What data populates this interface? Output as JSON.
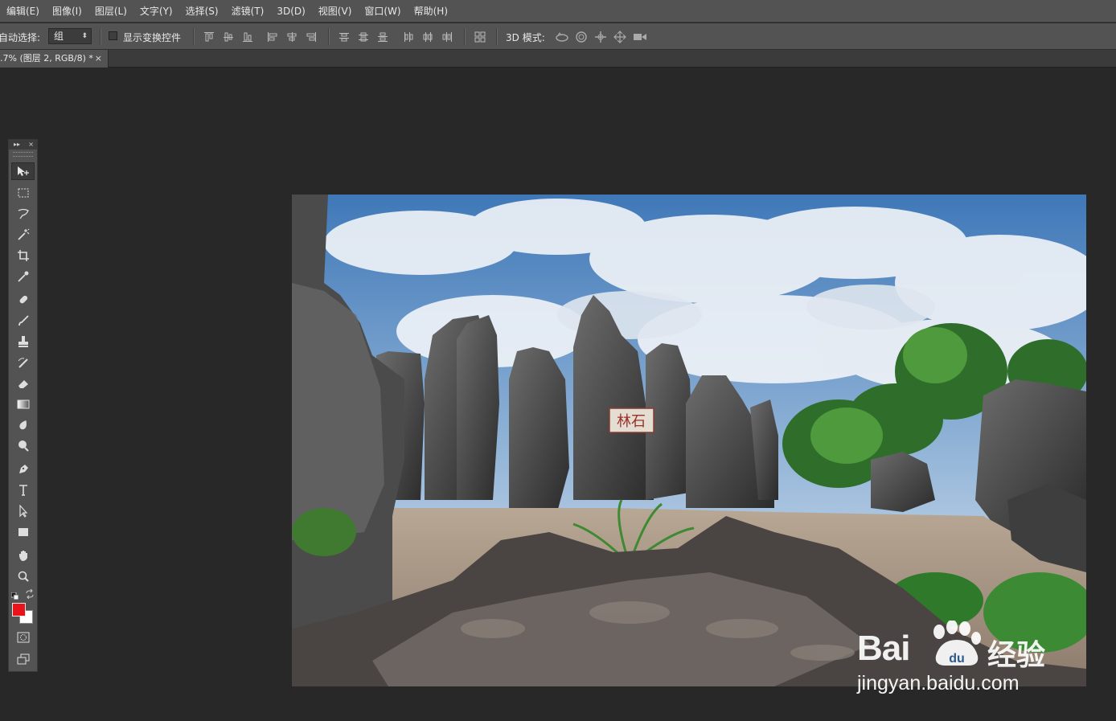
{
  "menu": {
    "items": [
      "编辑(E)",
      "图像(I)",
      "图层(L)",
      "文字(Y)",
      "选择(S)",
      "滤镜(T)",
      "3D(D)",
      "视图(V)",
      "窗口(W)",
      "帮助(H)"
    ]
  },
  "options": {
    "auto_select_label": "自动选择:",
    "auto_select_value": "组",
    "show_transform_label": "显示变换控件",
    "mode_3d_label": "3D 模式:"
  },
  "document_tab": {
    "title": ".7% (图层 2, RGB/8) *",
    "close": "×"
  },
  "tools_panel": {
    "collapse": "▸▸",
    "close": "×",
    "foreground_color": "#e8141a",
    "background_color": "#ffffff",
    "tools": [
      "move-icon",
      "marquee-icon",
      "lasso-icon",
      "magic-wand-icon",
      "crop-icon",
      "eyedropper-icon",
      "healing-brush-icon",
      "brush-icon",
      "clone-stamp-icon",
      "history-brush-icon",
      "eraser-icon",
      "gradient-icon",
      "blur-icon",
      "dodge-icon",
      "pen-icon",
      "type-icon",
      "path-selection-icon",
      "rectangle-icon",
      "hand-icon",
      "zoom-icon"
    ]
  },
  "canvas": {
    "sign_text": "林石"
  },
  "watermark": {
    "brand": "Bai",
    "brand_cn": "经验",
    "url": "jingyan.baidu.com"
  }
}
